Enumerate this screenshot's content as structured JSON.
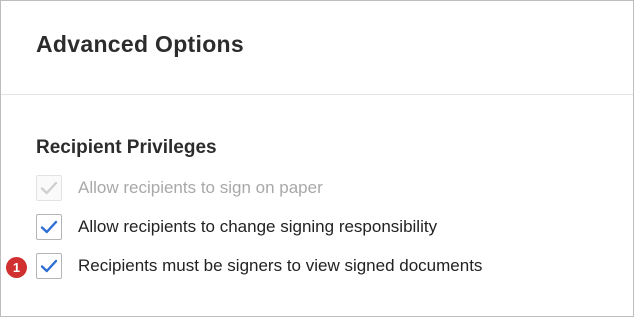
{
  "dialog": {
    "title": "Advanced Options"
  },
  "section": {
    "title": "Recipient Privileges"
  },
  "options": [
    {
      "label": "Allow recipients to sign on paper",
      "checked": true,
      "disabled": true
    },
    {
      "label": "Allow recipients to change signing responsibility",
      "checked": true,
      "disabled": false
    },
    {
      "label": "Recipients must be signers to view signed documents",
      "checked": true,
      "disabled": false
    }
  ],
  "callout": {
    "number": "1",
    "color": "#d0302f"
  },
  "colors": {
    "check_active": "#2d6fd6",
    "check_disabled": "#cfcfcf"
  }
}
